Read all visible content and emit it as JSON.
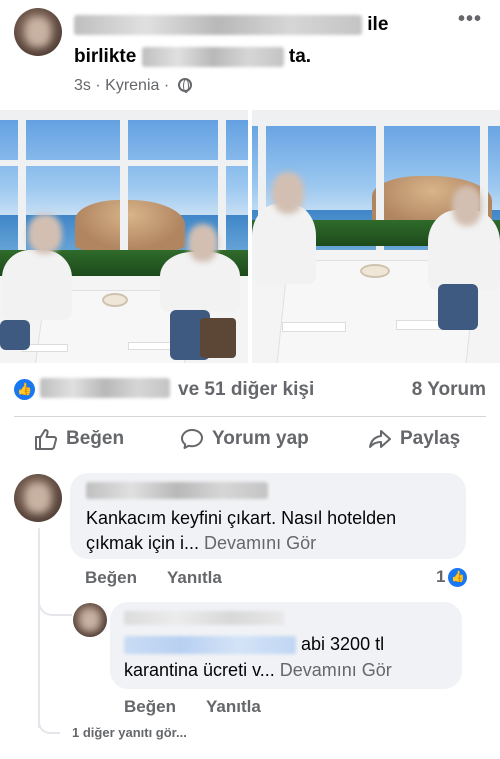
{
  "post": {
    "header_suffix": "ile",
    "header_with": "birlikte",
    "header_end": "ta.",
    "time": "3s",
    "separator": "·",
    "location": "Kyrenia",
    "separator2": "·",
    "privacy_icon": "globe-icon",
    "more_icon": "•••"
  },
  "reactions": {
    "icon": "like-thumb-icon",
    "others_text": "ve 51 diğer kişi",
    "comment_count": "8 Yorum"
  },
  "actions": {
    "like_label": "Beğen",
    "comment_label": "Yorum yap",
    "share_label": "Paylaş"
  },
  "comments": [
    {
      "text": "Kankacım keyfini çıkart. Nasıl hotelden çıkmak için i...",
      "see_more": "Devamını Gör",
      "like_label": "Beğen",
      "reply_label": "Yanıtla",
      "like_count": "1"
    }
  ],
  "reply": {
    "text_line1": "abi 3200 tl",
    "text_line2": "karantina ücreti v...",
    "see_more": "Devamını Gör",
    "like_label": "Beğen",
    "reply_label": "Yanıtla"
  },
  "more_replies": "1 diğer yanıtı gör...",
  "colors": {
    "accent": "#1877f2",
    "muted_text": "#65676b",
    "bubble": "#f0f2f5"
  }
}
